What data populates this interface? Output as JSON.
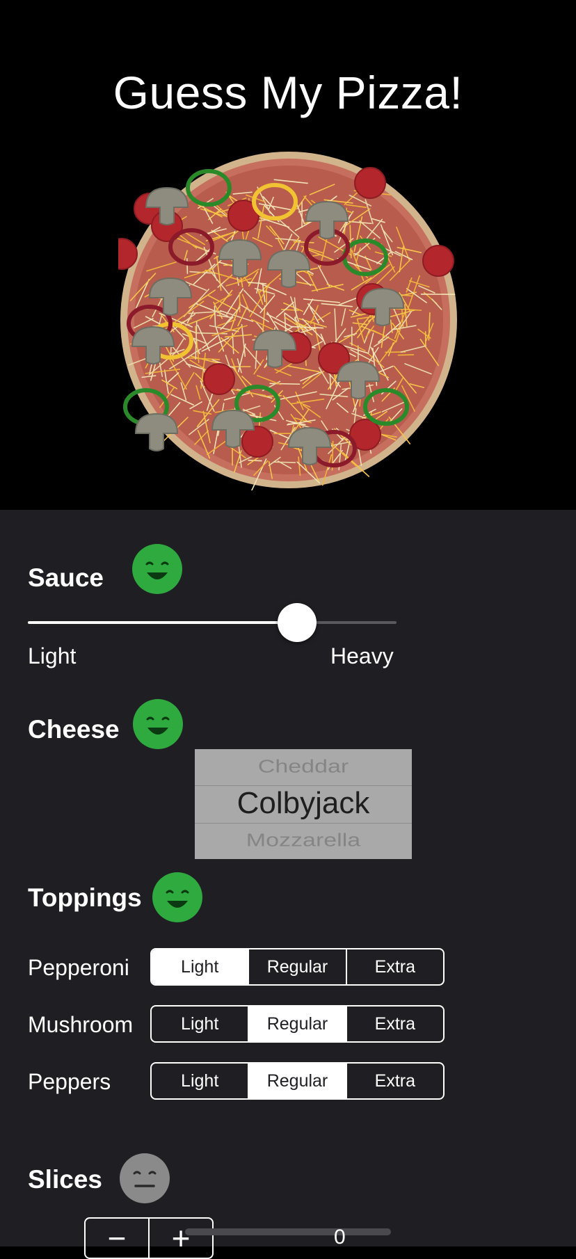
{
  "header": {
    "title": "Guess My Pizza!"
  },
  "sauce": {
    "label": "Sauce",
    "face_icon": "happy-face-icon",
    "face_color": "#2eaa3f",
    "slider_value": 0.83,
    "min_label": "Light",
    "max_label": "Heavy"
  },
  "cheese": {
    "label": "Cheese",
    "face_icon": "happy-face-icon",
    "face_color": "#2eaa3f",
    "picker": {
      "previous": "Cheddar",
      "selected": "Colbyjack",
      "next": "Mozzarella"
    }
  },
  "toppings": {
    "label": "Toppings",
    "face_icon": "happy-face-icon",
    "face_color": "#2eaa3f",
    "options": [
      "Light",
      "Regular",
      "Extra"
    ],
    "rows": [
      {
        "name": "Pepperoni",
        "selected": "Light"
      },
      {
        "name": "Mushroom",
        "selected": "Regular"
      },
      {
        "name": "Peppers",
        "selected": "Regular"
      }
    ]
  },
  "slices": {
    "label": "Slices",
    "face_icon": "neutral-face-icon",
    "face_color": "#8a8a8a",
    "minus_label": "−",
    "plus_label": "+",
    "value": "0"
  }
}
